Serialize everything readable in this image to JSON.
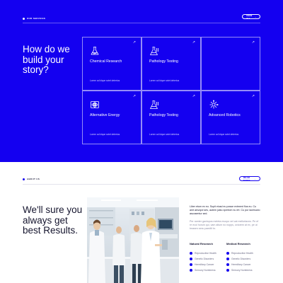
{
  "services": {
    "tag": "OUR SERVICES",
    "view_all": "VIEW ALL",
    "title": "How do we build your story?",
    "cards": [
      {
        "title": "Chemical Research",
        "icon": "flask-icon",
        "desc": "Lorem ad idque sxtet detertus"
      },
      {
        "title": "Pathology Testing",
        "icon": "beakers-icon",
        "desc": "Lorem ad idque sxtet detertus"
      },
      {
        "title": "",
        "icon": "",
        "desc": ""
      },
      {
        "title": "Alternative Energy",
        "icon": "atom-icon",
        "desc": "Lorem ad idque sxtet detertus"
      },
      {
        "title": "Pathology Testing",
        "icon": "beakers-icon",
        "desc": "Lorem ad idque sxtet detertus"
      },
      {
        "title": "Advanced Robotics",
        "icon": "robot-icon",
        "desc": "Lorem ad idque sxtet detertus"
      }
    ]
  },
  "about": {
    "tag": "ABOUT US",
    "read_more": "READ MORE",
    "title": "We'll sure you always get best Results.",
    "lead": "Liber etum ex eu. Supit eiusd eu posse extment flus eu. Cu amt aixvopd ses, autem justu xpmfom nu ert. Cu pur lacimucto ascosentur sed.",
    "sub": "Per ramter gavtopos meleta mucpo vel cat mellortaxns. Pe ef re ecol horuin qui, vam altum no nopps, oxtorem at ex, pe ut tmasen sexu paediit to.",
    "col1": {
      "heading": "Natural Research",
      "items": [
        "Reproductive Health",
        "Genetic Disorders",
        "Hereditary Cancer",
        "Sensory Numbness"
      ]
    },
    "col2": {
      "heading": "Medical Research",
      "items": [
        "Reproductive Health",
        "Genetic Disorders",
        "Hereditary Cancer",
        "Sensory Numbness"
      ]
    }
  },
  "colors": {
    "accent": "#1400f0",
    "text_dark": "#15152e",
    "text_muted": "#8a8aa3"
  }
}
